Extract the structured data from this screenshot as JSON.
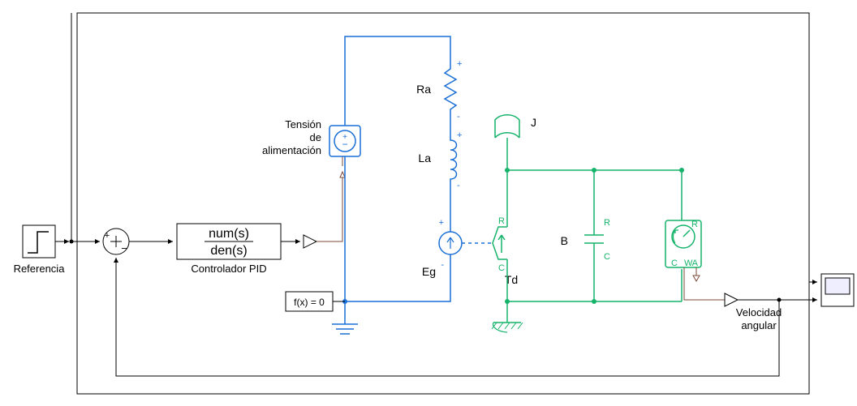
{
  "diagram": {
    "reference_label": "Referencia",
    "controller_num": "num(s)",
    "controller_den": "den(s)",
    "controller_label": "Controlador PID",
    "voltage_source_l1": "Tensión",
    "voltage_source_l2": "de",
    "voltage_source_l3": "alimentación",
    "Ra": "Ra",
    "La": "La",
    "Eg": "Eg",
    "J": "J",
    "B": "B",
    "Td": "Td",
    "C1": "C",
    "R1": "R",
    "C2": "C",
    "R2": "R",
    "C3": "C",
    "R3": "R",
    "W": "W",
    "A": "A",
    "solver_label": "f(x) = 0",
    "output_label_l1": "Velocidad",
    "output_label_l2": "angular",
    "plus": "+",
    "minus": "-",
    "minus2": "−"
  }
}
